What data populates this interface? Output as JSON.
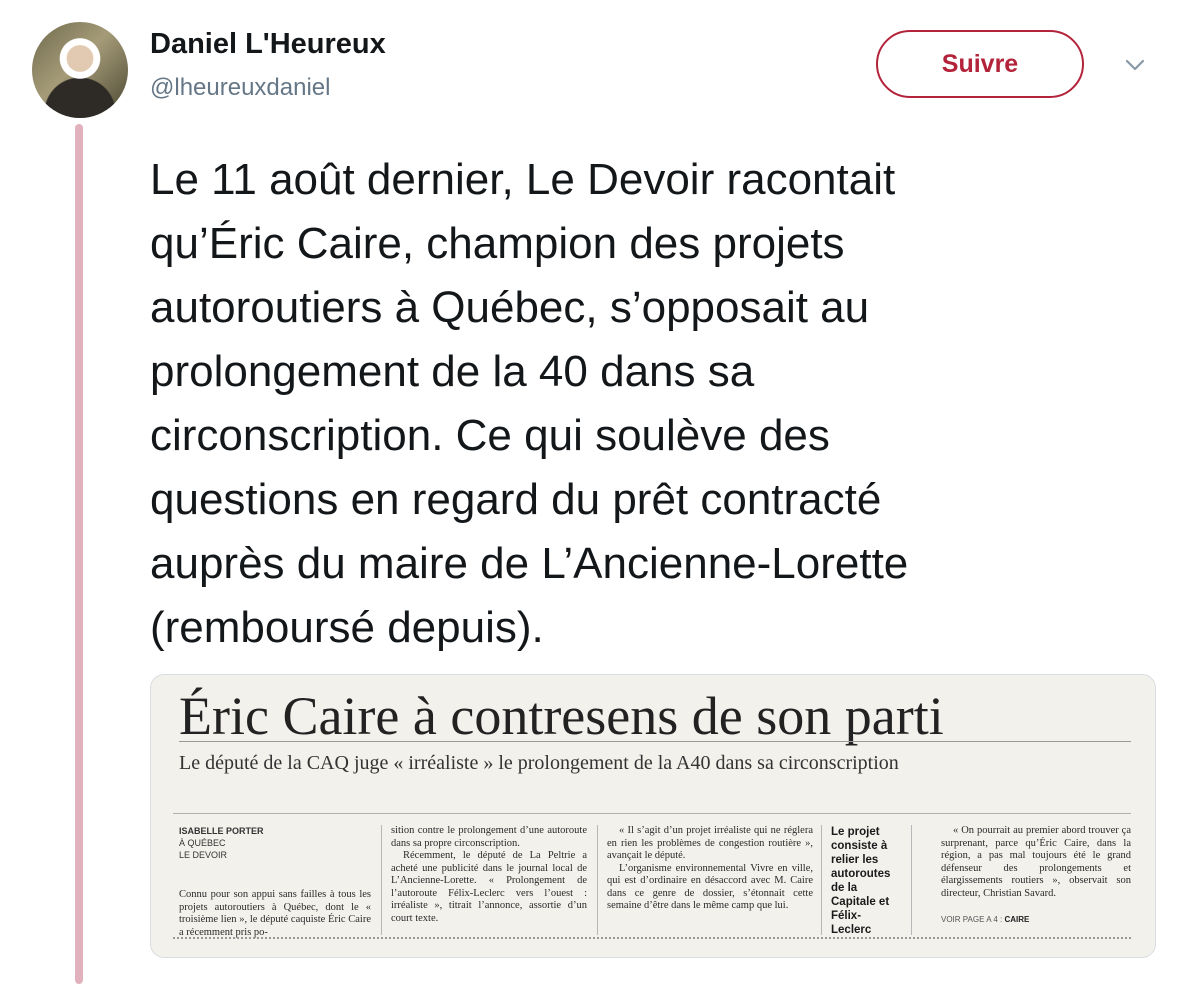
{
  "author": {
    "display_name": "Daniel L'Heureux",
    "handle": "@lheureuxdaniel"
  },
  "follow_button": {
    "label": "Suivre"
  },
  "tweet": {
    "text": "Le 11 août dernier, Le Devoir racontait\nqu’Éric Caire, champion des projets\nautoroutiers à Québec, s’opposait au\nprolongement de la 40 dans sa\ncirconscription. Ce qui soulève des\nquestions en regard du prêt contracté\nauprès du maire de L’Ancienne-Lorette\n(remboursé depuis)."
  },
  "article": {
    "headline": "Éric Caire à contresens de son parti",
    "subhead": "Le député de la CAQ juge « irréaliste » le prolongement de la A40 dans sa circonscription",
    "byline_name": "ISABELLE PORTER",
    "byline_place": "À QUÉBEC",
    "byline_outlet": "LE DEVOIR",
    "col1": "Connu pour son appui sans failles à tous les projets autoroutiers à Québec, dont le « troisième lien », le député caquiste Éric Caire a récemment pris po-",
    "col2a": "sition contre le prolongement d’une autoroute dans sa propre circonscription.",
    "col2b": "Récemment, le député de La Peltrie a acheté une publicité dans le journal local de L’Ancienne-Lorette. « Prolongement de l’autoroute Félix-Leclerc vers l’ouest : irréaliste », titrait l’annonce, assortie d’un court texte.",
    "col3a": "« Il s’agit d’un projet irréaliste qui ne réglera en rien les problèmes de congestion routière », avançait le député.",
    "col3b": "L’organisme environnemental Vivre en ville, qui est d’ordinaire en désaccord avec M. Caire dans ce genre de dossier, s’étonnait cette semaine d’être dans le même camp que lui.",
    "pull_quote": "Le projet consiste à relier les autoroutes de la Capitale et Félix-Leclerc",
    "col4": "« On pourrait au premier abord trouver ça surprenant, parce qu’Éric Caire, dans la région, a pas mal toujours été le grand défenseur des prolongements et élargissements routiers », observait son directeur, Christian Savard.",
    "see_page_prefix": "VOIR PAGE A 4 :",
    "see_page_ref": "CAIRE"
  },
  "icons": {
    "caret": "chevron-down-icon"
  },
  "colors": {
    "follow": "#b3243b",
    "thread_line": "#e1b2be",
    "handle": "#657786"
  }
}
